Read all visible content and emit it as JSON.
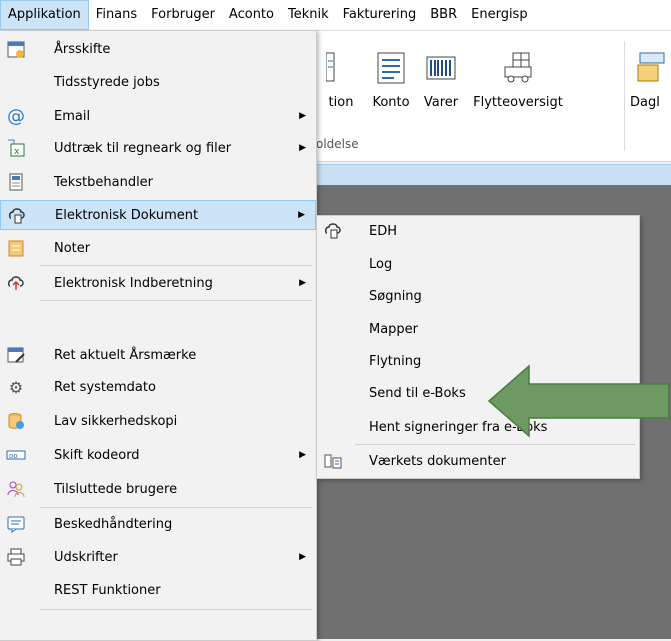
{
  "menubar": [
    {
      "label": "Applikation",
      "active": true
    },
    {
      "label": "Finans"
    },
    {
      "label": "Forbruger"
    },
    {
      "label": "Aconto"
    },
    {
      "label": "Teknik"
    },
    {
      "label": "Fakturering"
    },
    {
      "label": "BBR"
    },
    {
      "label": "Energisp"
    }
  ],
  "ribbon": {
    "buttons": [
      "tion",
      "Konto",
      "Varer",
      "Flytteoversigt",
      "Dagl"
    ],
    "group_label": "oldelse"
  },
  "main_menu": {
    "items": [
      {
        "label": "Årsskifte",
        "icon": "calendar-icon"
      },
      {
        "label": "Tidsstyrede jobs",
        "icon": ""
      },
      {
        "label": "Email",
        "icon": "at-icon",
        "submenu": true
      },
      {
        "label": "Udtræk til regneark og filer",
        "icon": "excel-export-icon",
        "submenu": true
      },
      {
        "label": "Tekstbehandler",
        "icon": "document-icon"
      },
      {
        "label": "Elektronisk Dokument",
        "icon": "edoc-icon",
        "submenu": true,
        "highlighted": true
      },
      {
        "label": "Noter",
        "icon": "notes-icon"
      },
      {
        "label": "Elektronisk Indberetning",
        "icon": "upload-icon",
        "submenu": true
      },
      {
        "label": "Ret aktuelt Årsmærke",
        "icon": "calendar-edit-icon"
      },
      {
        "label": "Ret systemdato",
        "icon": "settings-date-icon"
      },
      {
        "label": "Lav sikkerhedskopi",
        "icon": "database-backup-icon"
      },
      {
        "label": "Skift kodeord",
        "icon": "password-icon",
        "submenu": true
      },
      {
        "label": "Tilsluttede brugere",
        "icon": "users-icon"
      },
      {
        "label": "Beskedhåndtering",
        "icon": "message-icon"
      },
      {
        "label": "Udskrifter",
        "icon": "printer-icon",
        "submenu": true
      },
      {
        "label": "REST Funktioner",
        "icon": ""
      }
    ]
  },
  "sub_menu": {
    "items": [
      {
        "label": "EDH",
        "icon": "edoc-icon"
      },
      {
        "label": "Log"
      },
      {
        "label": "Søgning"
      },
      {
        "label": "Mapper"
      },
      {
        "label": "Flytning"
      },
      {
        "label": "Send til e-Boks"
      },
      {
        "label": "Hent signeringer fra e-Boks"
      },
      {
        "label": "Værkets dokumenter",
        "icon": "works-docs-icon"
      }
    ]
  },
  "colors": {
    "highlight": "#cce4f7",
    "arrow_fill": "#6d9a63",
    "arrow_stroke": "#4e7a45"
  }
}
